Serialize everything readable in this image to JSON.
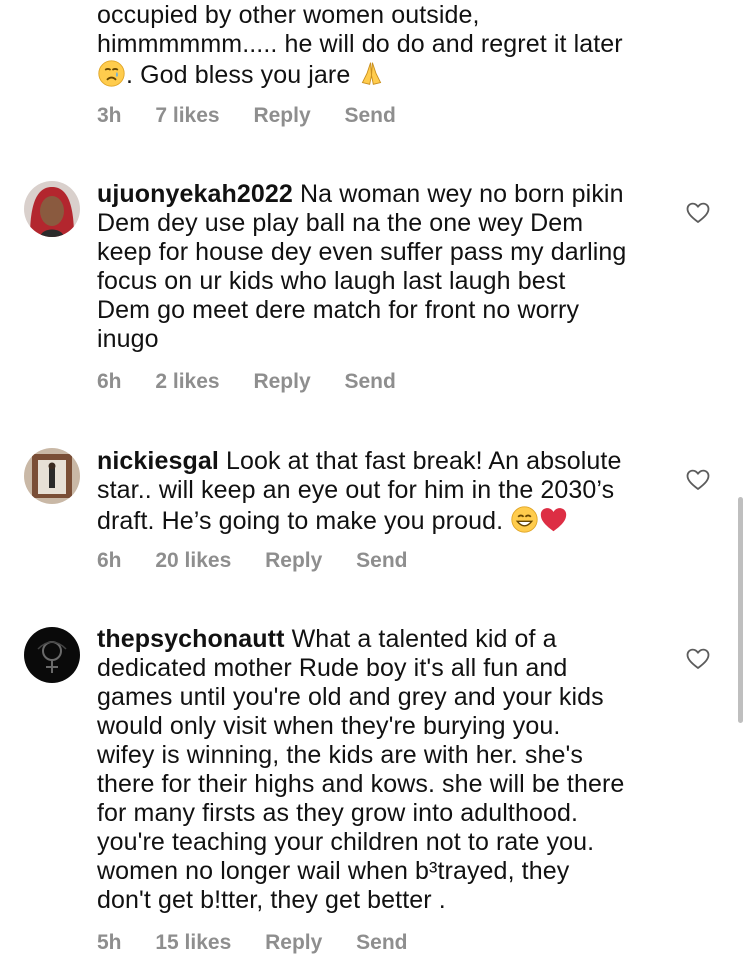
{
  "comments": [
    {
      "username": "",
      "lines": [
        "occupied by other women outside,",
        "himmmmmm..... he will do do and regret it later",
        ". God bless you jare"
      ],
      "time": "3h",
      "likes": "7 likes",
      "reply": "Reply",
      "send": "Send"
    },
    {
      "username": "ujuonyekah2022",
      "lines": [
        "Na woman wey no born pikin",
        "Dem dey use play ball  na the one wey Dem",
        "keep for house dey even suffer pass my darling",
        "focus on ur kids who laugh last laugh best",
        "Dem go meet dere match for front no worry",
        "inugo"
      ],
      "time": "6h",
      "likes": "2 likes",
      "reply": "Reply",
      "send": "Send"
    },
    {
      "username": "nickiesgal",
      "lines": [
        "Look at that fast break! An absolute",
        "star.. will keep an eye out for him in the 2030’s",
        "draft. He’s going to make you proud."
      ],
      "time": "6h",
      "likes": "20 likes",
      "reply": "Reply",
      "send": "Send"
    },
    {
      "username": "thepsychonautt",
      "lines": [
        "What a talented kid of a",
        "dedicated mother  Rude boy it's all fun and",
        "games until you're old and grey and your kids",
        "would only visit when they're burying you.",
        "wifey is winning, the kids are with her. she's",
        "there for their highs and kows. she will be there",
        "for many firsts as they grow into adulthood.",
        "you're teaching your children not to rate you.",
        "women no longer wail when b³trayed, they",
        "don't get b!tter, they get better ."
      ],
      "time": "5h",
      "likes": "15 likes",
      "reply": "Reply",
      "send": "Send"
    }
  ],
  "icons": {
    "like": "heart-outline-icon",
    "crying": "crying-face-emoji",
    "pray": "folded-hands-emoji",
    "grin": "grinning-face-emoji",
    "red_heart": "red-heart-emoji"
  },
  "colors": {
    "text": "#111111",
    "meta": "#8e8e8e",
    "scrollbar": "#bfbfbf"
  }
}
